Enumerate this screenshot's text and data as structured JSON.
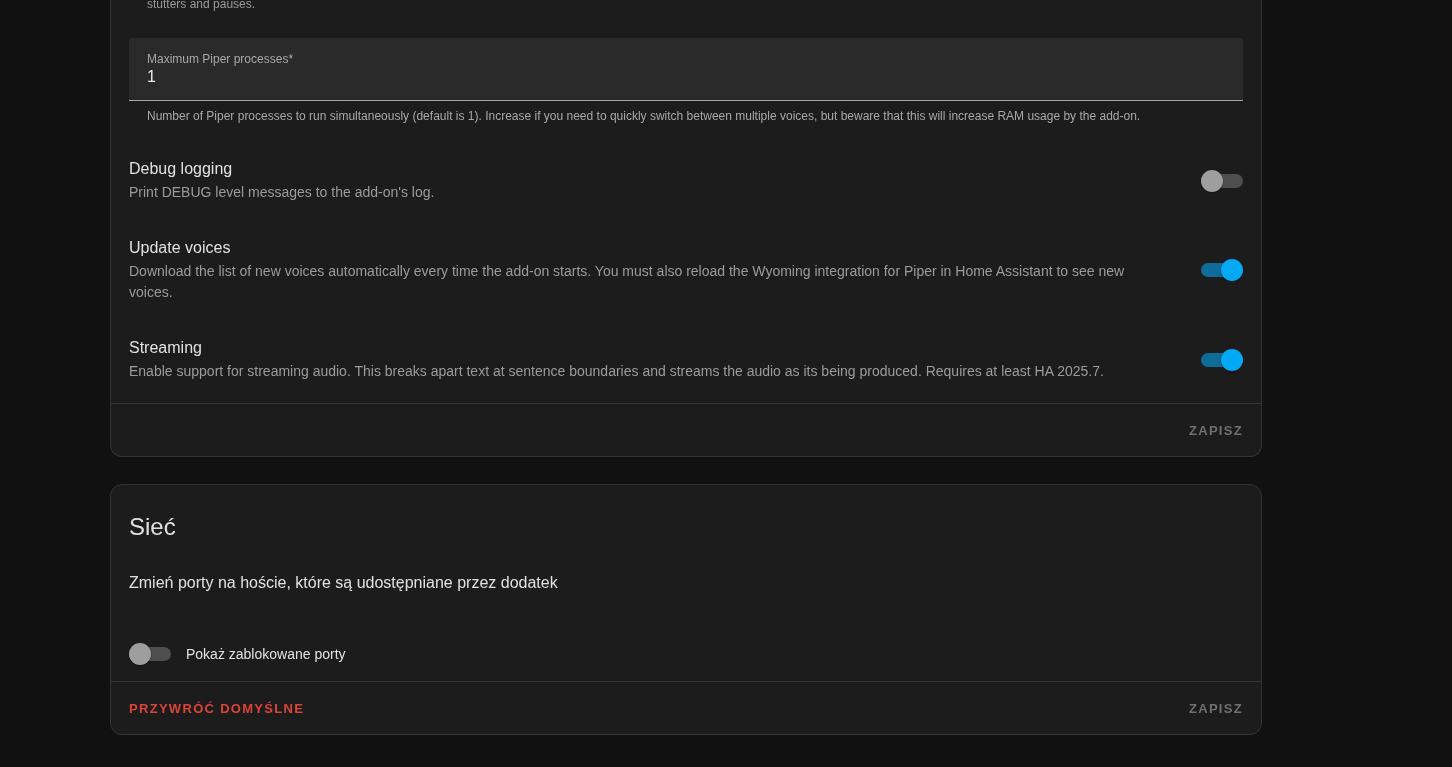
{
  "config_card": {
    "intro_tail": "stutters and pauses.",
    "field": {
      "label": "Maximum Piper processes*",
      "value": "1",
      "helper": "Number of Piper processes to run simultaneously (default is 1). Increase if you need to quickly switch between multiple voices, but beware that this will increase RAM usage by the add-on."
    },
    "options": [
      {
        "title": "Debug logging",
        "description": "Print DEBUG level messages to the add-on's log.",
        "on": false
      },
      {
        "title": "Update voices",
        "description": "Download the list of new voices automatically every time the add-on starts. You must also reload the Wyoming integration for Piper in Home Assistant to see new voices.",
        "on": true
      },
      {
        "title": "Streaming",
        "description": "Enable support for streaming audio. This breaks apart text at sentence boundaries and streams the audio as its being produced. Requires at least HA 2025.7.",
        "on": true
      }
    ],
    "save": "ZAPISZ"
  },
  "network_card": {
    "title": "Sieć",
    "description": "Zmień porty na hoście, które są udostępniane przez dodatek",
    "toggle": {
      "label": "Pokaż zablokowane porty",
      "on": false
    },
    "reset": "PRZYWRÓĆ DOMYŚLNE",
    "save": "ZAPISZ"
  }
}
